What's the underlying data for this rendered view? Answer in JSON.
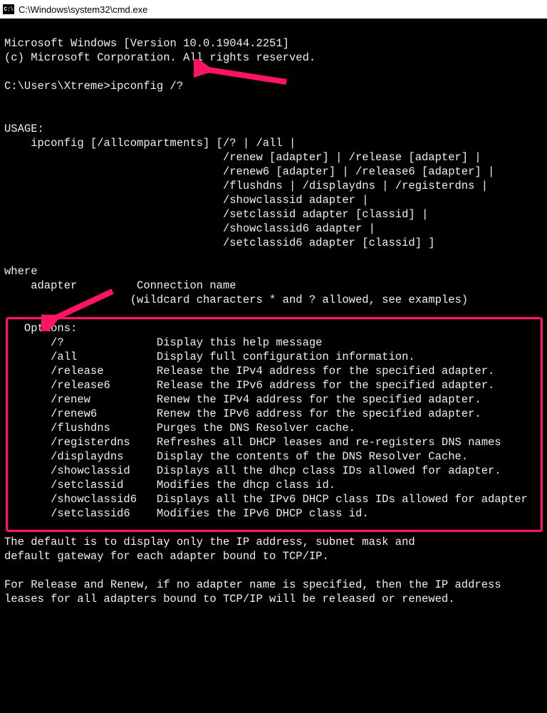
{
  "title": "C:\\Windows\\system32\\cmd.exe",
  "header": {
    "line1": "Microsoft Windows [Version 10.0.19044.2251]",
    "line2": "(c) Microsoft Corporation. All rights reserved."
  },
  "prompt_line": "C:\\Users\\Xtreme>ipconfig /?",
  "usage_label": "USAGE:",
  "usage_lines": [
    "    ipconfig [/allcompartments] [/? | /all |",
    "                                 /renew [adapter] | /release [adapter] |",
    "                                 /renew6 [adapter] | /release6 [adapter] |",
    "                                 /flushdns | /displaydns | /registerdns |",
    "                                 /showclassid adapter |",
    "                                 /setclassid adapter [classid] |",
    "                                 /showclassid6 adapter |",
    "                                 /setclassid6 adapter [classid] ]"
  ],
  "where_label": "where",
  "where_line1": "    adapter         Connection name",
  "where_line2": "                   (wildcard characters * and ? allowed, see examples)",
  "options_label": "   Options:",
  "options": [
    {
      "flag": "/?",
      "desc": "Display this help message"
    },
    {
      "flag": "/all",
      "desc": "Display full configuration information."
    },
    {
      "flag": "/release",
      "desc": "Release the IPv4 address for the specified adapter."
    },
    {
      "flag": "/release6",
      "desc": "Release the IPv6 address for the specified adapter."
    },
    {
      "flag": "/renew",
      "desc": "Renew the IPv4 address for the specified adapter."
    },
    {
      "flag": "/renew6",
      "desc": "Renew the IPv6 address for the specified adapter."
    },
    {
      "flag": "/flushdns",
      "desc": "Purges the DNS Resolver cache."
    },
    {
      "flag": "/registerdns",
      "desc": "Refreshes all DHCP leases and re-registers DNS names"
    },
    {
      "flag": "/displaydns",
      "desc": "Display the contents of the DNS Resolver Cache."
    },
    {
      "flag": "/showclassid",
      "desc": "Displays all the dhcp class IDs allowed for adapter."
    },
    {
      "flag": "/setclassid",
      "desc": "Modifies the dhcp class id."
    },
    {
      "flag": "/showclassid6",
      "desc": "Displays all the IPv6 DHCP class IDs allowed for adapter"
    },
    {
      "flag": "/setclassid6",
      "desc": "Modifies the IPv6 DHCP class id."
    }
  ],
  "footer": {
    "p1l1": "The default is to display only the IP address, subnet mask and",
    "p1l2": "default gateway for each adapter bound to TCP/IP.",
    "p2l1": "For Release and Renew, if no adapter name is specified, then the IP address",
    "p2l2": "leases for all adapters bound to TCP/IP will be released or renewed."
  },
  "annotation_color": "#ff1464"
}
